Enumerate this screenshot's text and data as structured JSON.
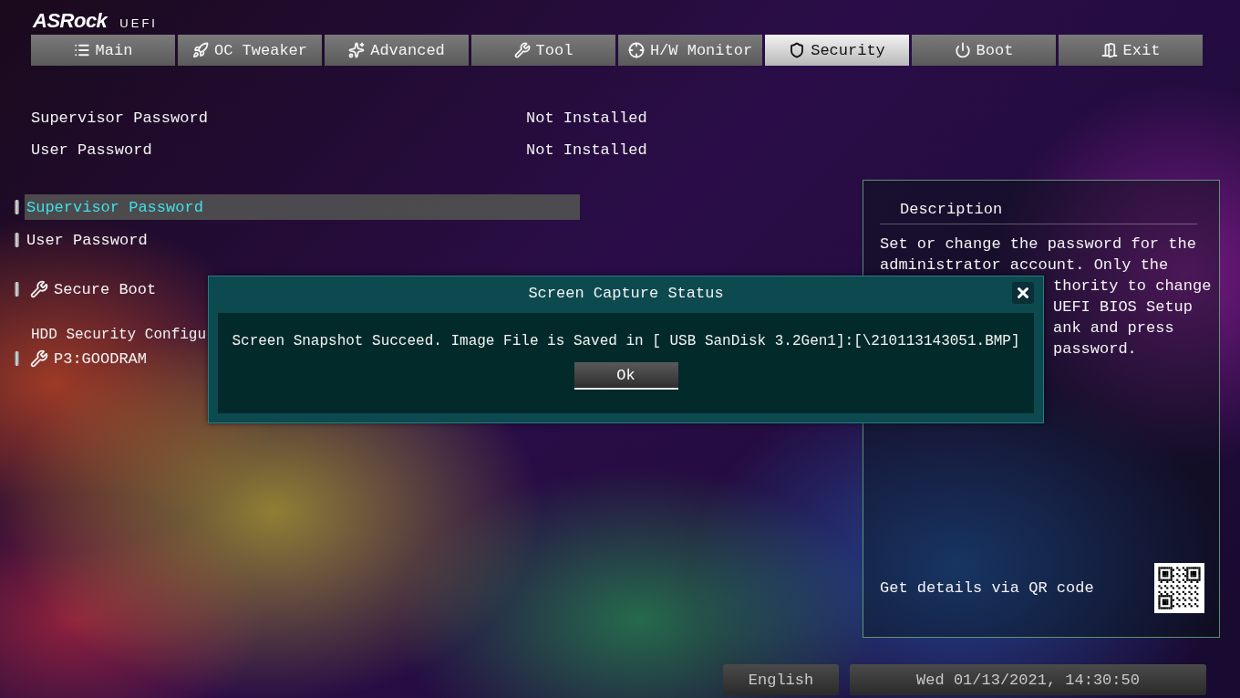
{
  "logo": {
    "brand": "ASRock",
    "product": "UEFI"
  },
  "tabs": [
    {
      "label": "Main",
      "selected": false
    },
    {
      "label": "OC Tweaker",
      "selected": false
    },
    {
      "label": "Advanced",
      "selected": false
    },
    {
      "label": "Tool",
      "selected": false
    },
    {
      "label": "H/W Monitor",
      "selected": false
    },
    {
      "label": "Security",
      "selected": true
    },
    {
      "label": "Boot",
      "selected": false
    },
    {
      "label": "Exit",
      "selected": false
    }
  ],
  "info_rows": [
    {
      "label": "Supervisor Password",
      "value": "Not Installed"
    },
    {
      "label": "User Password",
      "value": "Not Installed"
    }
  ],
  "menu": [
    {
      "kind": "item",
      "label": "Supervisor Password",
      "selected": true
    },
    {
      "kind": "item",
      "label": "User Password",
      "selected": false
    },
    {
      "kind": "submenu",
      "label": "Secure Boot",
      "selected": false
    },
    {
      "kind": "heading",
      "label": "HDD Security Configu"
    },
    {
      "kind": "submenu",
      "label": "P3:GOODRAM",
      "selected": false
    }
  ],
  "description": {
    "title": "Description",
    "lines": [
      {
        "text": "Set or change the password for the",
        "covered": false
      },
      {
        "text": "administrator account. Only the",
        "covered": false
      },
      {
        "text": "thority to change",
        "covered": true
      },
      {
        "text": "UEFI BIOS Setup",
        "covered": true
      },
      {
        "text": "ank and press",
        "covered": true
      },
      {
        "text": "password.",
        "covered": true
      }
    ],
    "qr_caption": "Get details via QR code"
  },
  "dialog": {
    "title": "Screen Capture Status",
    "message": "Screen Snapshot Succeed. Image File is Saved in  [ USB  SanDisk 3.2Gen1]:[\\210113143051.BMP]",
    "button": "Ok"
  },
  "status_bar": {
    "language": "English",
    "datetime": "Wed 01/13/2021, 14:30:50"
  }
}
